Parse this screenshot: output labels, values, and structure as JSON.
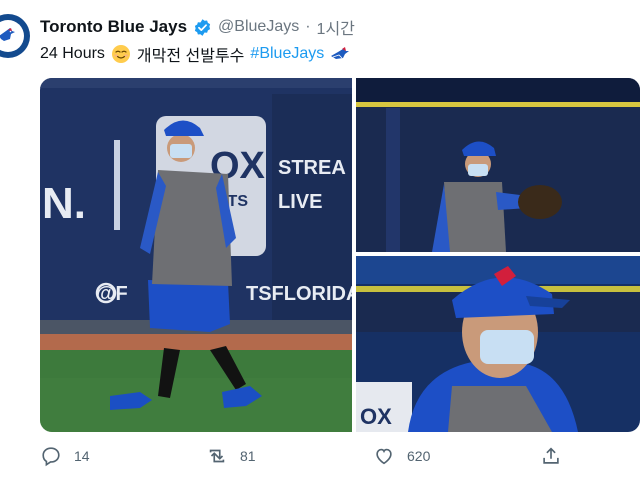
{
  "tweet": {
    "author_name": "Toronto Blue Jays",
    "handle": "@BlueJays",
    "separator": "·",
    "time": "1시간",
    "text_main": "24 Hours",
    "text_korean": "개막전 선발투수",
    "hashtag": "#BlueJays"
  },
  "media": {
    "photo1_sign_lines": [
      "STREA",
      "LIVE"
    ],
    "photo1_sign_brand": "OX",
    "photo1_sign_sub": "RTS",
    "photo1_wall_text": "@F",
    "photo1_wall_text_2": "TSFLORIDA",
    "photo1_wall_left": "N.",
    "photo3_wall_text": "OX"
  },
  "actions": {
    "reply_count": "14",
    "retweet_count": "81",
    "like_count": "620"
  },
  "colors": {
    "brand_blue": "#134a8e",
    "link_blue": "#1d9bf0",
    "verified_blue": "#1d9bf0",
    "muted_text": "#536471"
  },
  "icons": {
    "avatar": "blue-jays-logo",
    "verified": "verified-badge-icon",
    "emoji_1": "relieved-face-emoji",
    "emoji_2": "blue-jay-emoji",
    "reply": "reply-icon",
    "retweet": "retweet-icon",
    "like": "heart-icon",
    "share": "share-icon"
  }
}
